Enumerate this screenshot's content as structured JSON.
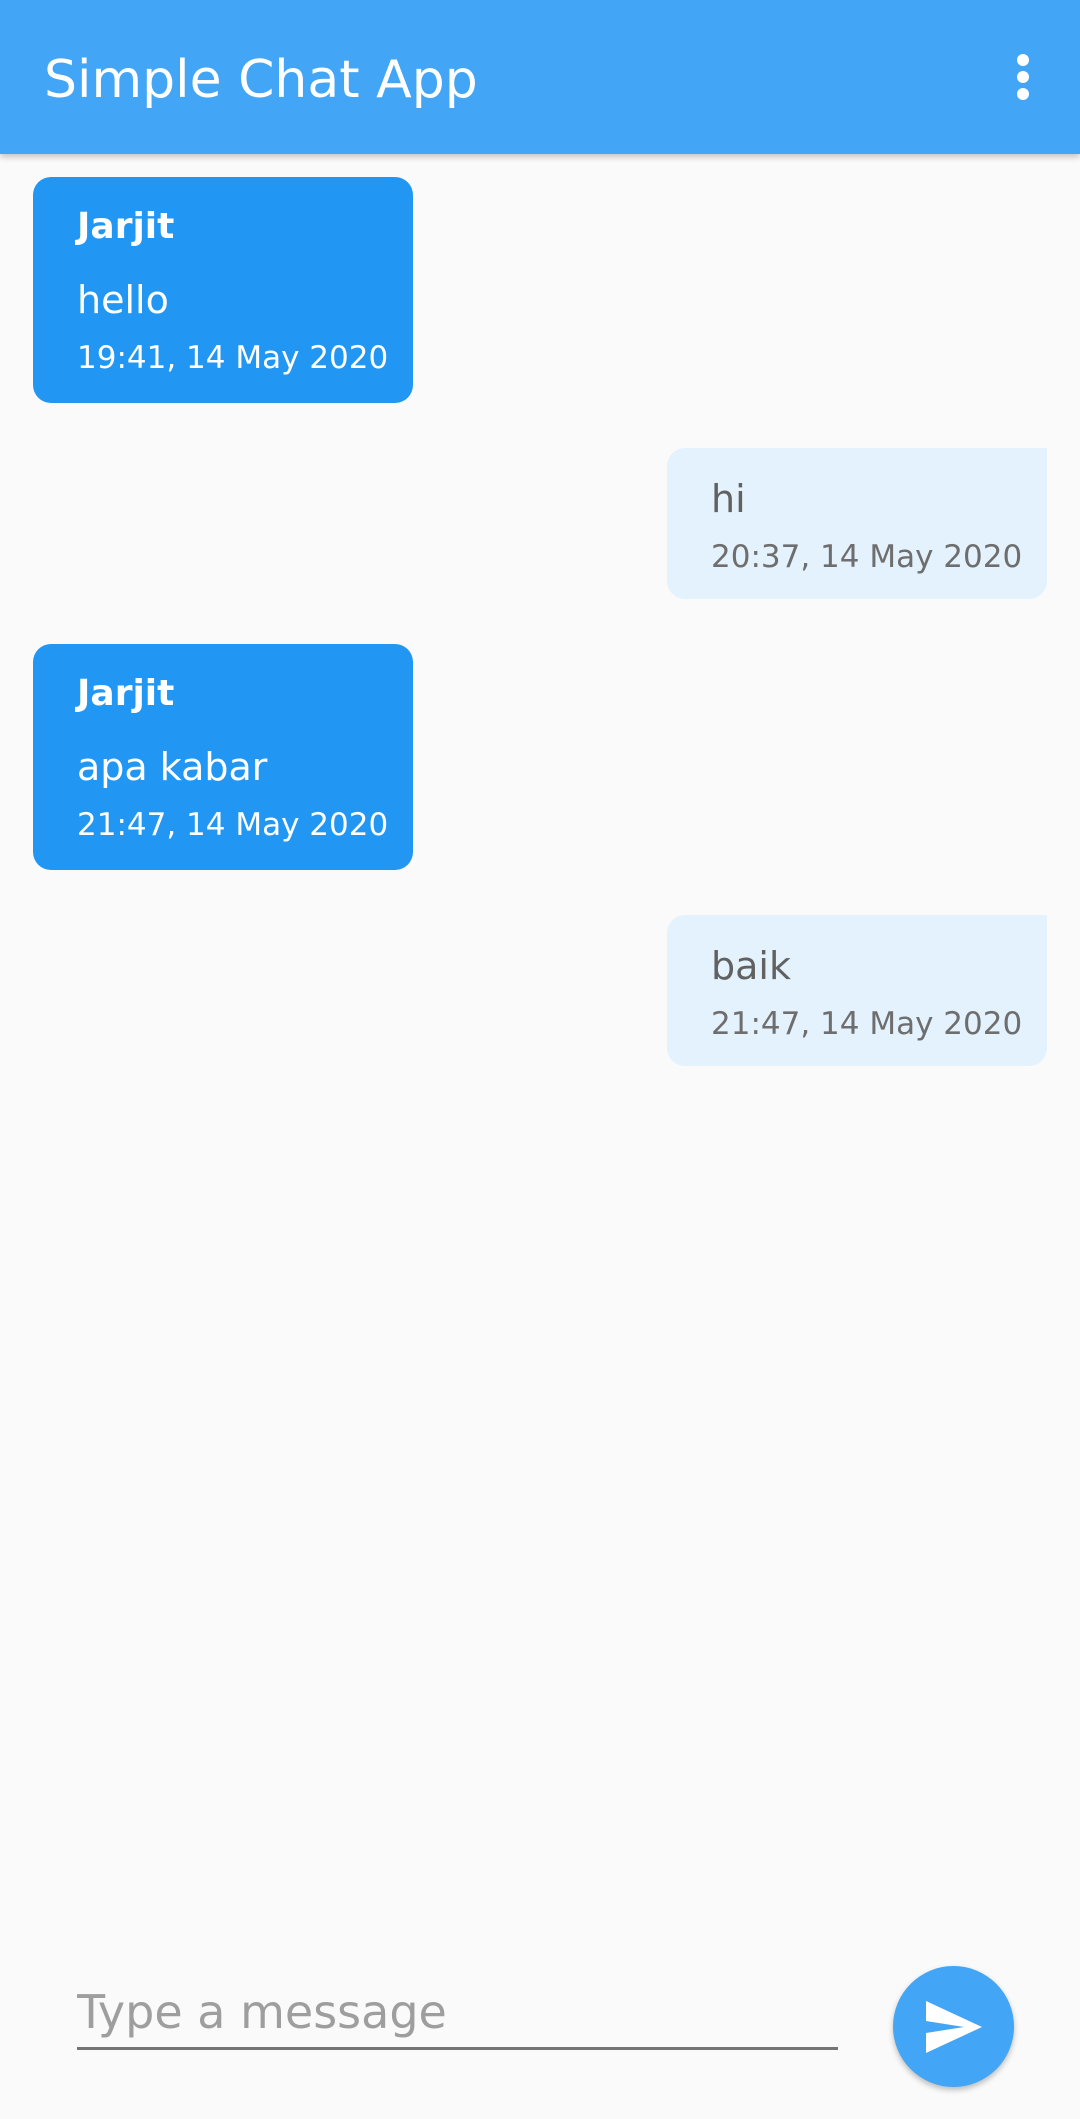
{
  "app_bar": {
    "title": "Simple Chat App",
    "overflow_icon": "more-vert-icon"
  },
  "messages": [
    {
      "direction": "incoming",
      "sender": "Jarjit",
      "text": "hello",
      "time": "19:41, 14 May 2020"
    },
    {
      "direction": "outgoing",
      "text": "hi",
      "time": "20:37, 14 May 2020"
    },
    {
      "direction": "incoming",
      "sender": "Jarjit",
      "text": "apa kabar",
      "time": "21:47, 14 May 2020"
    },
    {
      "direction": "outgoing",
      "text": "baik",
      "time": "21:47, 14 May 2020"
    }
  ],
  "composer": {
    "value": "",
    "placeholder": "Type a message",
    "send_icon": "send-icon"
  },
  "colors": {
    "app_bar": "#42a5f5",
    "incoming_bubble": "#2196f3",
    "outgoing_bubble": "#e3f2fd",
    "send_button": "#42a5f5",
    "background": "#fafafa"
  }
}
